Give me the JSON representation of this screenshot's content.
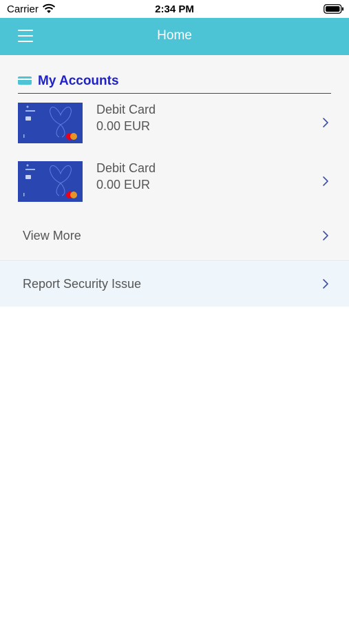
{
  "status_bar": {
    "carrier": "Carrier",
    "time": "2:34 PM"
  },
  "nav": {
    "title": "Home",
    "menu_icon": "hamburger-menu-icon"
  },
  "accounts": {
    "title": "My Accounts",
    "header_icon": "card-icon",
    "items": [
      {
        "name": "Debit Card",
        "balance": "0.00 EUR"
      },
      {
        "name": "Debit Card",
        "balance": "0.00 EUR"
      }
    ],
    "view_more": "View More"
  },
  "report": {
    "label": "Report Security Issue"
  },
  "colors": {
    "nav_bar": "#4dc3d6",
    "accent": "#1f22c8",
    "card_blue": "#2a46b0",
    "panel_bg": "#f6f6f6",
    "report_bg": "#eef6fb"
  }
}
